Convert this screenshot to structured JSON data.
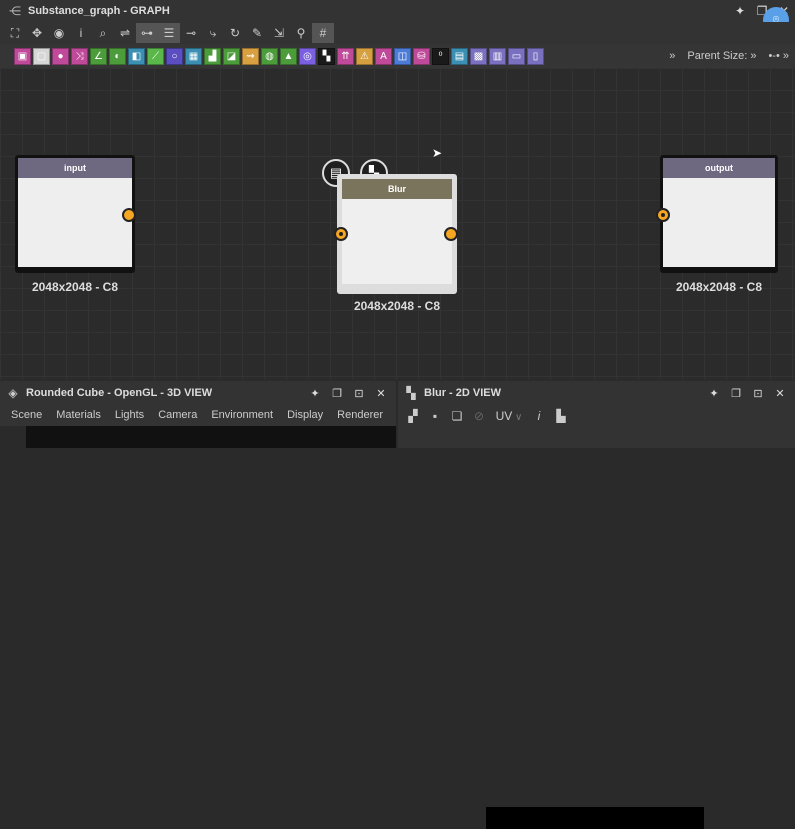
{
  "window": {
    "title": "Substance_graph - GRAPH",
    "controls": [
      "pin",
      "restore",
      "close"
    ]
  },
  "toolbar1": {
    "buttons": [
      {
        "name": "frame-icon",
        "glyph": "⛶"
      },
      {
        "name": "move-icon",
        "glyph": "✥"
      },
      {
        "name": "camera-icon",
        "glyph": "◉"
      },
      {
        "name": "info-icon",
        "glyph": "i"
      },
      {
        "name": "zoom-icon",
        "glyph": "⌕"
      },
      {
        "name": "connect-icon",
        "glyph": "⇌"
      },
      {
        "name": "graph-icon",
        "glyph": "⊶"
      },
      {
        "name": "list-icon",
        "glyph": "☰"
      },
      {
        "name": "link-icon",
        "glyph": "⊸"
      },
      {
        "name": "path-icon",
        "glyph": "⤷"
      },
      {
        "name": "refresh-icon",
        "glyph": "↻"
      },
      {
        "name": "tools-icon",
        "glyph": "✎"
      },
      {
        "name": "export-icon",
        "glyph": "⇲"
      },
      {
        "name": "brush-icon",
        "glyph": "⚲"
      },
      {
        "name": "grid-icon",
        "glyph": "#"
      }
    ]
  },
  "toolbar2": {
    "palette": [
      {
        "name": "bitmap-node-icon",
        "color": "#c04a9a",
        "glyph": "▣"
      },
      {
        "name": "svg-node-icon",
        "color": "#d6d6d6",
        "glyph": "▢"
      },
      {
        "name": "uniform-color-icon",
        "color": "#c04a9a",
        "glyph": "●"
      },
      {
        "name": "transform-icon",
        "color": "#c04a9a",
        "glyph": "⤨"
      },
      {
        "name": "gradient-icon",
        "color": "#4c9c3c",
        "glyph": "∠"
      },
      {
        "name": "levels-icon",
        "color": "#4c9c3c",
        "glyph": "◐"
      },
      {
        "name": "hsl-icon",
        "color": "#3a8fb3",
        "glyph": "◧"
      },
      {
        "name": "curve-icon",
        "color": "#5ab84a",
        "glyph": "⟋"
      },
      {
        "name": "blend-icon",
        "color": "#5a4ec0",
        "glyph": "○"
      },
      {
        "name": "pixel-processor-icon",
        "color": "#3a8fb3",
        "glyph": "▦"
      },
      {
        "name": "blur-icon",
        "color": "#4c9c3c",
        "glyph": "▟"
      },
      {
        "name": "sharpen-icon",
        "color": "#4c9c3c",
        "glyph": "◪"
      },
      {
        "name": "warp-icon",
        "color": "#d8a040",
        "glyph": "⇝"
      },
      {
        "name": "normal-icon",
        "color": "#4c9c3c",
        "glyph": "◍"
      },
      {
        "name": "emboss-icon",
        "color": "#4c9c3c",
        "glyph": "▲"
      },
      {
        "name": "color-wheel-icon",
        "color": "#7a60e0",
        "glyph": "◎"
      },
      {
        "name": "value-01-icon",
        "color": "#1a1a1a",
        "glyph": "▚"
      },
      {
        "name": "output-icon",
        "color": "#c04a9a",
        "glyph": "⇈"
      },
      {
        "name": "warning-icon",
        "color": "#d6a040",
        "glyph": "⚠"
      },
      {
        "name": "text-icon",
        "color": "#c04a9a",
        "glyph": "A"
      },
      {
        "name": "crop-icon",
        "color": "#4c7cd8",
        "glyph": "◫"
      },
      {
        "name": "fill-icon",
        "color": "#c04a9a",
        "glyph": "⛁"
      },
      {
        "name": "fx-map-icon",
        "color": "#1a1a1a",
        "glyph": "⁰"
      },
      {
        "name": "distance-icon",
        "color": "#3a8fb3",
        "glyph": "▤"
      },
      {
        "name": "splatter-icon",
        "color": "#7a70c0",
        "glyph": "▩"
      },
      {
        "name": "tile-icon",
        "color": "#7a70c0",
        "glyph": "▥"
      },
      {
        "name": "shape-icon",
        "color": "#7a70c0",
        "glyph": "▭"
      },
      {
        "name": "comment-icon",
        "color": "#7a70c0",
        "glyph": "▯"
      }
    ],
    "more_label": "»",
    "parent_size_label": "Parent Size: »",
    "extra_label": "•-• »"
  },
  "graph": {
    "nodes": {
      "input": {
        "title": "input",
        "header_color": "#6e6880",
        "size_label": "2048x2048 - C8"
      },
      "blur": {
        "title": "Blur",
        "header_color": "#7a745c",
        "size_label": "2048x2048 - C8"
      },
      "output": {
        "title": "output",
        "header_color": "#6e6880",
        "size_label": "2048x2048 - C8"
      }
    },
    "port_color": "#f5a623",
    "badges": [
      {
        "name": "document-icon",
        "glyph": "▤"
      },
      {
        "name": "checker-icon",
        "glyph": "▚"
      }
    ]
  },
  "panel3d": {
    "title": "Rounded Cube - OpenGL - 3D VIEW",
    "menu": [
      "Scene",
      "Materials",
      "Lights",
      "Camera",
      "Environment",
      "Display",
      "Renderer"
    ]
  },
  "panel2d": {
    "title": "Blur - 2D VIEW",
    "uv_label": "UV"
  }
}
